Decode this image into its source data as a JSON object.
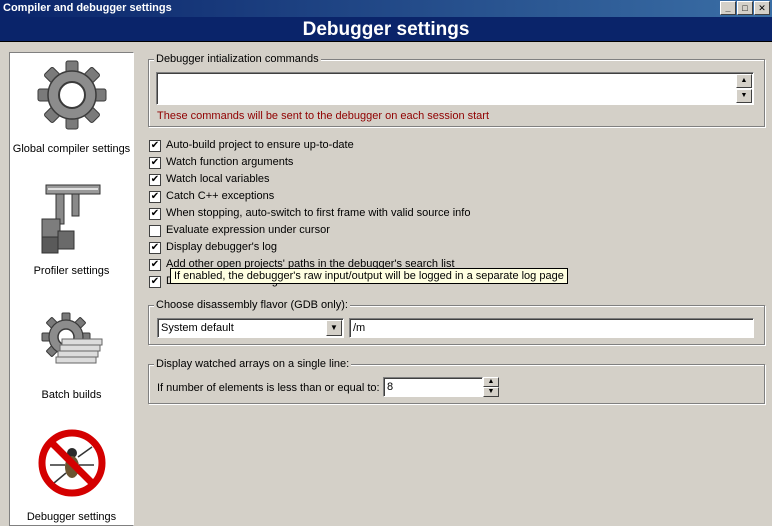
{
  "window": {
    "title": "Compiler and debugger settings",
    "minimize": "_",
    "maximize": "□",
    "close": "✕"
  },
  "header": {
    "title": "Debugger settings"
  },
  "sidebar": {
    "items": [
      {
        "label": "Global compiler settings",
        "icon": "gear-icon"
      },
      {
        "label": "Profiler settings",
        "icon": "caliper-icon"
      },
      {
        "label": "Batch builds",
        "icon": "batch-gear-icon"
      },
      {
        "label": "Debugger settings",
        "icon": "no-bug-icon"
      }
    ]
  },
  "init_commands": {
    "legend": "Debugger intialization commands",
    "value": "",
    "note": "These commands will be sent to the debugger on each session start",
    "scroll_up": "▲",
    "scroll_down": "▼"
  },
  "options": [
    {
      "label": "Auto-build project to ensure up-to-date",
      "checked": true
    },
    {
      "label": "Watch function arguments",
      "checked": true
    },
    {
      "label": "Watch local variables",
      "checked": true
    },
    {
      "label": "Catch C++ exceptions",
      "checked": true
    },
    {
      "label": "When stopping, auto-switch to first frame with valid source info",
      "checked": true
    },
    {
      "label": "Evaluate expression under cursor",
      "checked": false
    },
    {
      "label": "Display debugger's log",
      "checked": true
    },
    {
      "label": "Add other open projects' paths in the debugger's search list",
      "checked": true
    },
    {
      "label": "Do *not* run the debugee",
      "checked": true
    }
  ],
  "check_mark": "✔",
  "tooltip": "If enabled, the debugger's raw input/output will be logged in a separate log page",
  "disassembly": {
    "legend": "Choose disassembly flavor (GDB only):",
    "selected": "System default",
    "arrow": "▼",
    "extra_value": "/m"
  },
  "watched_arrays": {
    "legend": "Display watched arrays on a single line:",
    "label": "If number of elements is less than or equal to:",
    "value": "8",
    "up": "▲",
    "down": "▼"
  }
}
